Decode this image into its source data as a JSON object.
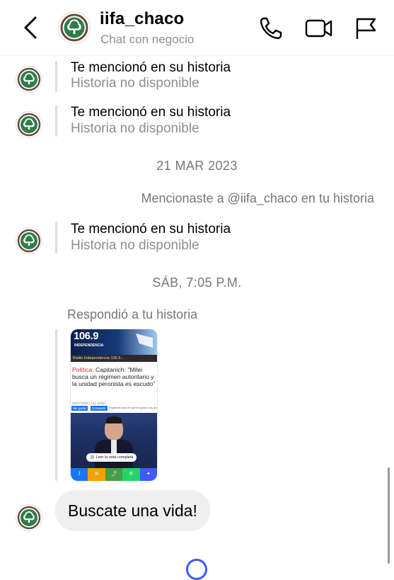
{
  "header": {
    "name": "iifa_chaco",
    "subtitle": "Chat con negocio"
  },
  "messages": {
    "mention_title": "Te mencionó en su historia",
    "mention_sub": "Historia no disponible",
    "date1": "21 MAR 2023",
    "my_mention": "Mencionaste a @iifa_chaco en tu historia",
    "date2": "SÁB, 7:05 P.M.",
    "reply_label": "Respondió a tu historia",
    "bubble_text": "Buscate una vida!"
  },
  "story_card": {
    "station_logo": "106.9",
    "station_sub": "INDEPENDENCIA",
    "radio_bar": "Radio Independencia 106.9...",
    "section": "Política:",
    "headline": "Capitanich: \"Milei busca un régimen autoritario y la unidad peronista es escudo\"",
    "meta": "09/07/2023 | 135 visitas",
    "like_btn": "Me gusta",
    "share_btn": "Compartir",
    "share_note": "Regístrate para ver qué les gusta a tus amigos.",
    "read_more": "Leer la nota completa"
  },
  "colors": {
    "muted": "#8e8e8e",
    "bubble": "#efefef",
    "accent": "#3d5afe",
    "logo_green": "#2e7d4a"
  }
}
